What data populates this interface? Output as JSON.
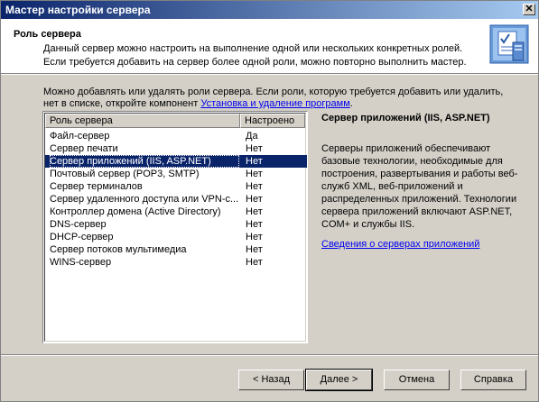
{
  "window": {
    "title": "Мастер настройки сервера",
    "close_glyph": "✕"
  },
  "header": {
    "title": "Роль сервера",
    "line1": "Данный сервер можно настроить на выполнение одной или нескольких конкретных ролей.",
    "line2": "Если требуется добавить на сервер более одной роли, можно повторно выполнить мастер.",
    "icon": "wizard-server-icon"
  },
  "intro": {
    "line1": "Можно добавлять или удалять роли сервера. Если роли, которую требуется добавить или удалить,",
    "line2_prefix": "нет в списке, откройте компонент ",
    "line2_link": "Установка и удаление программ",
    "line2_suffix": "."
  },
  "table": {
    "columns": [
      "Роль сервера",
      "Настроено"
    ],
    "rows": [
      [
        "Файл-сервер",
        "Да"
      ],
      [
        "Сервер печати",
        "Нет"
      ],
      [
        "Сервер приложений (IIS, ASP.NET)",
        "Нет"
      ],
      [
        "Почтовый сервер (POP3, SMTP)",
        "Нет"
      ],
      [
        "Сервер терминалов",
        "Нет"
      ],
      [
        "Сервер удаленного доступа или VPN-с...",
        "Нет"
      ],
      [
        "Контроллер домена (Active Directory)",
        "Нет"
      ],
      [
        "DNS-сервер",
        "Нет"
      ],
      [
        "DHCP-сервер",
        "Нет"
      ],
      [
        "Сервер потоков мультимедиа",
        "Нет"
      ],
      [
        "WINS-сервер",
        "Нет"
      ]
    ],
    "selected_index": 2
  },
  "details": {
    "title": "Сервер приложений (IIS, ASP.NET)",
    "body": "Серверы приложений обеспечивают базовые технологии, необходимые для построения, развертывания и работы веб-служб XML, веб-приложений и распределенных приложений. Технологии сервера приложений включают ASP.NET, COM+ и службы IIS.",
    "link": "Сведения о серверах приложений"
  },
  "buttons": {
    "back": "< Назад",
    "next": "Далее >",
    "cancel": "Отмена",
    "help": "Справка"
  },
  "colors": {
    "selection": "#0a246a",
    "titlebar": "#0a246a",
    "link": "#0000ee"
  }
}
